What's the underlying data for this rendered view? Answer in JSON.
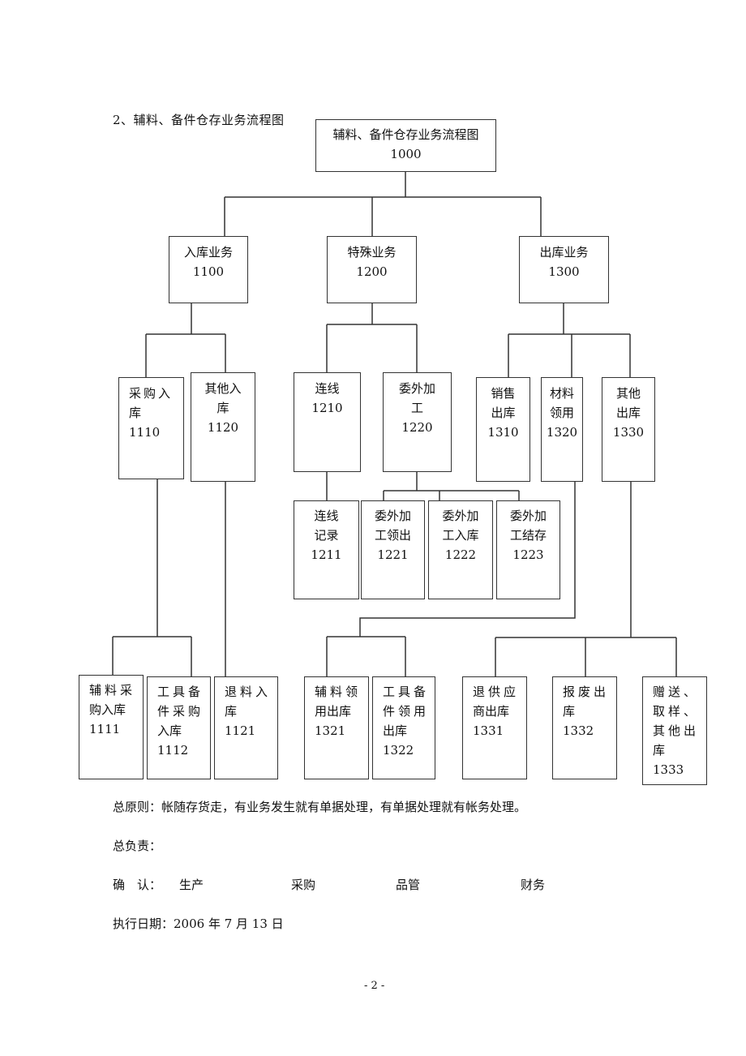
{
  "document": {
    "section_title": "2、辅料、备件仓存业务流程图",
    "page_number": "- 2 -"
  },
  "flowchart": {
    "root": {
      "code": "1000",
      "lines": [
        "辅料、备件仓存业务流程图",
        "1000"
      ]
    },
    "level2": [
      {
        "code": "1100",
        "lines": [
          "入库业务",
          "1100"
        ]
      },
      {
        "code": "1200",
        "lines": [
          "特殊业务",
          "1200"
        ]
      },
      {
        "code": "1300",
        "lines": [
          "出库业务",
          "1300"
        ]
      }
    ],
    "level3": [
      {
        "code": "1110",
        "lines": [
          "采购入",
          "库",
          "1110"
        ]
      },
      {
        "code": "1120",
        "lines": [
          "其他入",
          "库",
          "1120"
        ]
      },
      {
        "code": "1210",
        "lines": [
          "连线",
          "1210"
        ]
      },
      {
        "code": "1220",
        "lines": [
          "委外加",
          "工",
          "1220"
        ]
      },
      {
        "code": "1310",
        "lines": [
          "销售",
          "出库",
          "1310"
        ]
      },
      {
        "code": "1320",
        "lines": [
          "材料",
          "领用",
          "1320"
        ]
      },
      {
        "code": "1330",
        "lines": [
          "其他",
          "出库",
          "1330"
        ]
      }
    ],
    "level4": [
      {
        "code": "1211",
        "lines": [
          "连线",
          "记录",
          "1211"
        ]
      },
      {
        "code": "1221",
        "lines": [
          "委外加",
          "工领出",
          "1221"
        ]
      },
      {
        "code": "1222",
        "lines": [
          "委外加",
          "工入库",
          "1222"
        ]
      },
      {
        "code": "1223",
        "lines": [
          "委外加",
          "工结存",
          "1223"
        ]
      }
    ],
    "level5": [
      {
        "code": "1111",
        "lines": [
          "辅料采",
          "购入库",
          "1111"
        ]
      },
      {
        "code": "1112",
        "lines": [
          "工具备",
          "件采购",
          "入库",
          "1112"
        ]
      },
      {
        "code": "1121",
        "lines": [
          "退料入",
          "库",
          "1121"
        ]
      },
      {
        "code": "1321",
        "lines": [
          "辅料领",
          "用出库",
          "1321"
        ]
      },
      {
        "code": "1322",
        "lines": [
          "工具备",
          "件领用",
          "出库",
          "1322"
        ]
      },
      {
        "code": "1331",
        "lines": [
          "退供应",
          "商出库",
          "1331"
        ]
      },
      {
        "code": "1332",
        "lines": [
          "报废出",
          "库",
          "1332"
        ]
      },
      {
        "code": "1333",
        "lines": [
          "赠送、",
          "取样、",
          "其他出",
          "库",
          "1333"
        ]
      }
    ]
  },
  "footer": {
    "principle": "总原则：帐随存货走，有业务发生就有单据处理，有单据处理就有帐务处理。",
    "responsible": "总负责：",
    "confirm_label": "确　认：",
    "confirm_items": [
      "生产",
      "采购",
      "品管",
      "财务"
    ],
    "execution_date": "执行日期：2006 年 7 月 13 日"
  }
}
